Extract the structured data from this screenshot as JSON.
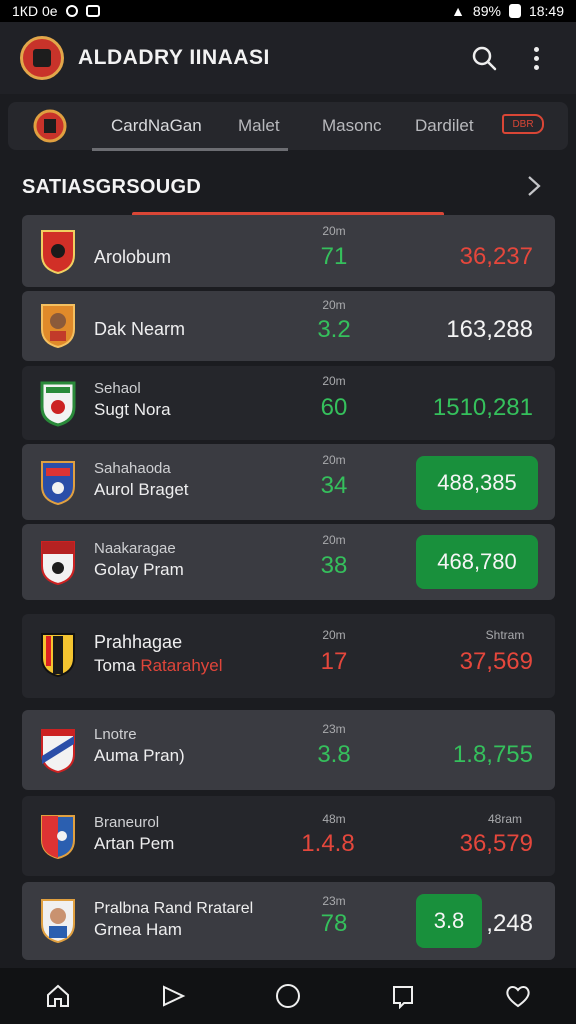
{
  "status_bar": {
    "left_text": "1КD 0e",
    "battery": "89%",
    "time": "18:49"
  },
  "app_bar": {
    "title": "ALDADRY IINAASI"
  },
  "tabs": [
    {
      "label": "CardNaGan"
    },
    {
      "label": "Malet"
    },
    {
      "label": "Masonc"
    },
    {
      "label": "Dardilet"
    }
  ],
  "tab_badge": "DBR",
  "section": {
    "title": "SATIASGRSOUGD"
  },
  "rows": [
    {
      "line1": "",
      "line2": "Arolobum",
      "mini_mid": "20m",
      "mid": "71",
      "right": "36,237"
    },
    {
      "line1": "",
      "line2": "Dak Nearm",
      "mini_mid": "20m",
      "mid": "3.2",
      "right": "163,288"
    },
    {
      "line1": "Sehaol",
      "line2": "Sugt Nora",
      "mini_mid": "20m",
      "mid": "60",
      "right": "1510,281"
    },
    {
      "line1": "Sahahaoda",
      "line2": "Aurol Braget",
      "mini_mid": "20m",
      "mid": "34",
      "right": "488,385"
    },
    {
      "line1": "Naakaragae",
      "line2": "Golay Pram",
      "mini_mid": "20m",
      "mid": "38",
      "right": "468,780"
    },
    {
      "line1": "Prahhagae",
      "line2_a": "Toma",
      "line2_b": "Ratarahyel",
      "mini_mid": "20m",
      "mini_right": "Shtram",
      "mid": "17",
      "right": "37,569"
    },
    {
      "line1": "Lnotre",
      "line2": "Auma Pran)",
      "mini_mid": "23m",
      "mid": "3.8",
      "right": "1.8,755"
    },
    {
      "line1": "Braneurol",
      "line2": "Artan Pem",
      "mini_mid": "48m",
      "mini_right": "48ram",
      "mid": "1.4.8",
      "right": "36,579"
    },
    {
      "line1": "Pralbna Rand Rratarel",
      "line2": "Grnea Ham",
      "mini_mid": "23m",
      "mid": "78",
      "right_pill": "3.8",
      "right_rest": ",248"
    }
  ],
  "bottom_nav": [
    "home",
    "play",
    "circle",
    "square",
    "heart"
  ]
}
